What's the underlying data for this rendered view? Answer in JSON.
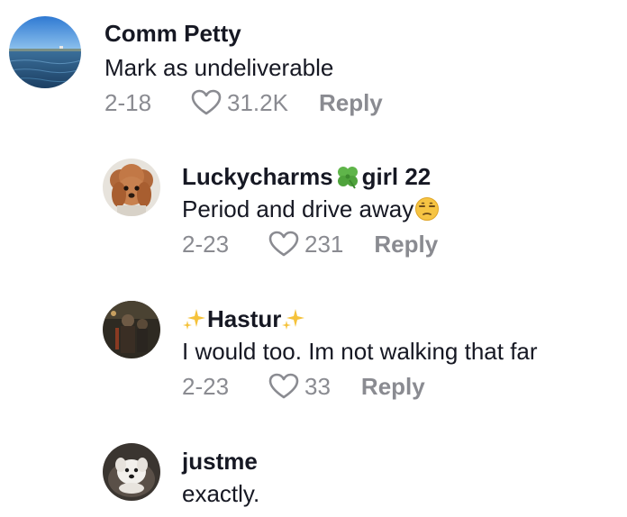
{
  "comments": [
    {
      "username": "Comm Petty",
      "text": "Mark as undeliverable",
      "date": "2-18",
      "likes": "31.2K",
      "reply_label": "Reply"
    },
    {
      "username_pre": "Luckycharms",
      "username_post": "girl 22",
      "username_emoji": "four-leaf-clover-icon",
      "text": "Period and drive away",
      "text_emoji": "unamused-face-icon",
      "date": "2-23",
      "likes": "231",
      "reply_label": "Reply"
    },
    {
      "username_emoji": "sparkles-icon",
      "username": "Hastur",
      "text": "I would too. Im not walking that far",
      "date": "2-23",
      "likes": "33",
      "reply_label": "Reply"
    },
    {
      "username": "justme",
      "text": "exactly."
    }
  ],
  "colors": {
    "text_primary": "#161823",
    "text_secondary": "#8a8b91",
    "background": "#ffffff"
  }
}
